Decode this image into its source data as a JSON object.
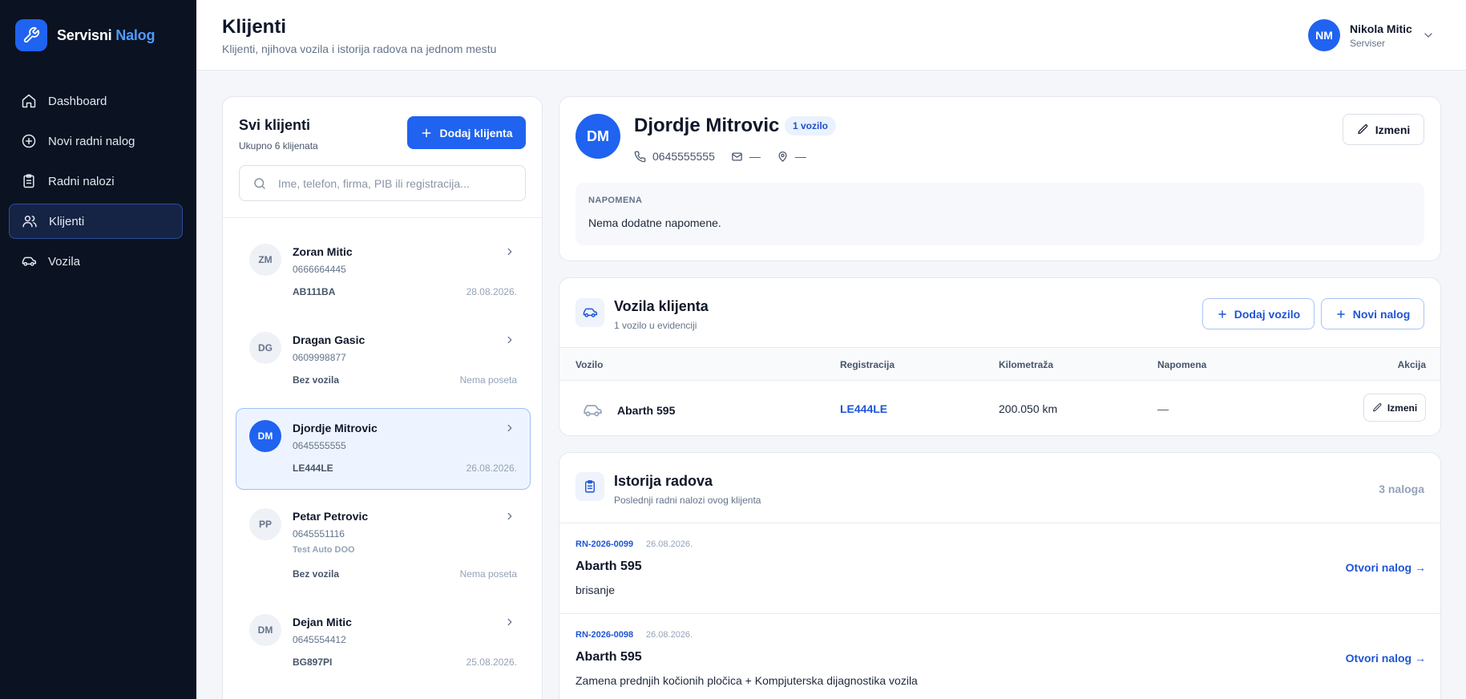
{
  "brand": {
    "name": "Servisni",
    "accent": "Nalog",
    "icon": "wrench-icon"
  },
  "nav": [
    {
      "label": "Dashboard",
      "icon": "home-icon"
    },
    {
      "label": "Novi radni nalog",
      "icon": "plus-circle-icon"
    },
    {
      "label": "Radni nalozi",
      "icon": "clipboard-icon"
    },
    {
      "label": "Klijenti",
      "icon": "users-icon",
      "active": true
    },
    {
      "label": "Vozila",
      "icon": "car-icon"
    }
  ],
  "header": {
    "title": "Klijenti",
    "subtitle": "Klijenti, njihova vozila i istorija radova na jednom mestu"
  },
  "user": {
    "initials": "NM",
    "name": "Nikola Mitic",
    "role": "Serviser"
  },
  "clients_panel": {
    "title": "Svi klijenti",
    "subtitle": "Ukupno 6 klijenata",
    "add_label": "Dodaj klijenta",
    "search_placeholder": "Ime, telefon, firma, PIB ili registracija...",
    "search_value": "",
    "items": [
      {
        "initials": "ZM",
        "name": "Zoran Mitic",
        "phone": "0666664445",
        "company": "",
        "plate": "AB111BA",
        "date": "28.08.2026."
      },
      {
        "initials": "DG",
        "name": "Dragan Gasic",
        "phone": "0609998877",
        "company": "",
        "plate": "Bez vozila",
        "date": "Nema poseta"
      },
      {
        "initials": "DM",
        "name": "Djordje Mitrovic",
        "phone": "0645555555",
        "company": "",
        "plate": "LE444LE",
        "date": "26.08.2026.",
        "active": true
      },
      {
        "initials": "PP",
        "name": "Petar Petrovic",
        "phone": "0645551116",
        "company": "Test Auto DOO",
        "plate": "Bez vozila",
        "date": "Nema poseta"
      },
      {
        "initials": "DM",
        "name": "Dejan Mitic",
        "phone": "0645554412",
        "company": "",
        "plate": "BG897PI",
        "date": "25.08.2026."
      }
    ]
  },
  "client_detail": {
    "initials": "DM",
    "name": "Djordje Mitrovic",
    "badge": "1 vozilo",
    "phone": "0645555555",
    "email": "—",
    "address": "—",
    "edit_label": "Izmeni",
    "note_label": "NAPOMENA",
    "note_text": "Nema dodatne napomene."
  },
  "vehicles": {
    "title": "Vozila klijenta",
    "subtitle": "1 vozilo u evidenciji",
    "add_vehicle_label": "Dodaj vozilo",
    "new_order_label": "Novi nalog",
    "columns": {
      "vehicle": "Vozilo",
      "registration": "Registracija",
      "mileage": "Kilometraža",
      "note": "Napomena",
      "action": "Akcija"
    },
    "rows": [
      {
        "vehicle": "Abarth 595",
        "registration": "LE444LE",
        "mileage": "200.050 km",
        "note": "—",
        "action_label": "Izmeni"
      }
    ]
  },
  "history": {
    "title": "Istorija radova",
    "subtitle": "Poslednji radni nalozi ovog klijenta",
    "count": "3 naloga",
    "orders": [
      {
        "number": "RN-2026-0099",
        "date": "26.08.2026.",
        "vehicle": "Abarth 595",
        "description": "brisanje",
        "open_label": "Otvori nalog →"
      },
      {
        "number": "RN-2026-0098",
        "date": "26.08.2026.",
        "vehicle": "Abarth 595",
        "description": "Zamena prednjih kočionih pločica + Kompjuterska dijagnostika vozila",
        "open_label": "Otvori nalog →"
      }
    ]
  },
  "colors": {
    "primary": "#1f63f0",
    "sidebar_bg": "#0b1221",
    "accent_text": "#4d9bff",
    "link": "#1f55d6"
  }
}
